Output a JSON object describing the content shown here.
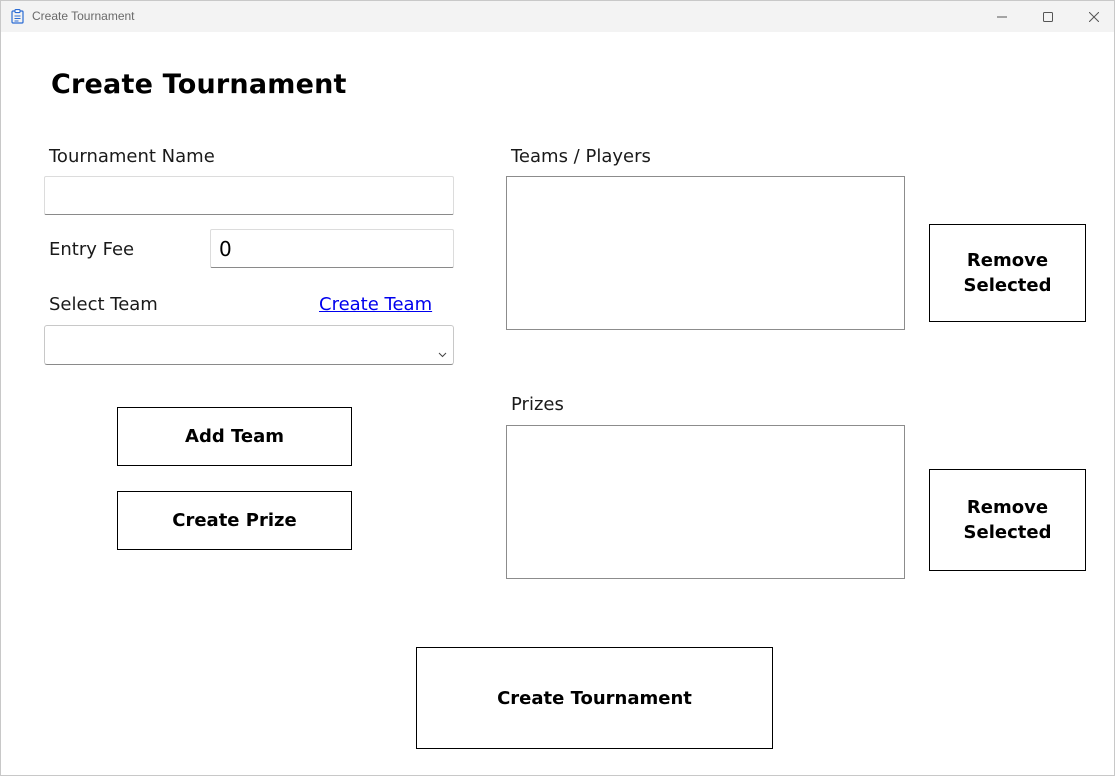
{
  "window": {
    "title": "Create Tournament",
    "app_icon": "clipboard-icon",
    "controls": [
      "minimize-icon",
      "maximize-icon",
      "close-icon"
    ]
  },
  "page": {
    "heading": "Create Tournament"
  },
  "form": {
    "tournament_name_label": "Tournament Name",
    "tournament_name_value": "",
    "entry_fee_label": "Entry Fee",
    "entry_fee_value": "0",
    "select_team_label": "Select Team",
    "create_team_link": "Create Team",
    "select_team_value": ""
  },
  "buttons": {
    "add_team": "Add Team",
    "create_prize": "Create Prize",
    "remove_team_line1": "Remove",
    "remove_team_line2": "Selected",
    "remove_prize_line1": "Remove",
    "remove_prize_line2": "Selected",
    "create_tournament": "Create Tournament"
  },
  "lists": {
    "teams_label": "Teams / Players",
    "teams_items": [],
    "prizes_label": "Prizes",
    "prizes_items": []
  },
  "colors": {
    "link": "#0000ee",
    "titlebar": "#f3f3f3",
    "icon_accent": "#2b6cd4"
  }
}
